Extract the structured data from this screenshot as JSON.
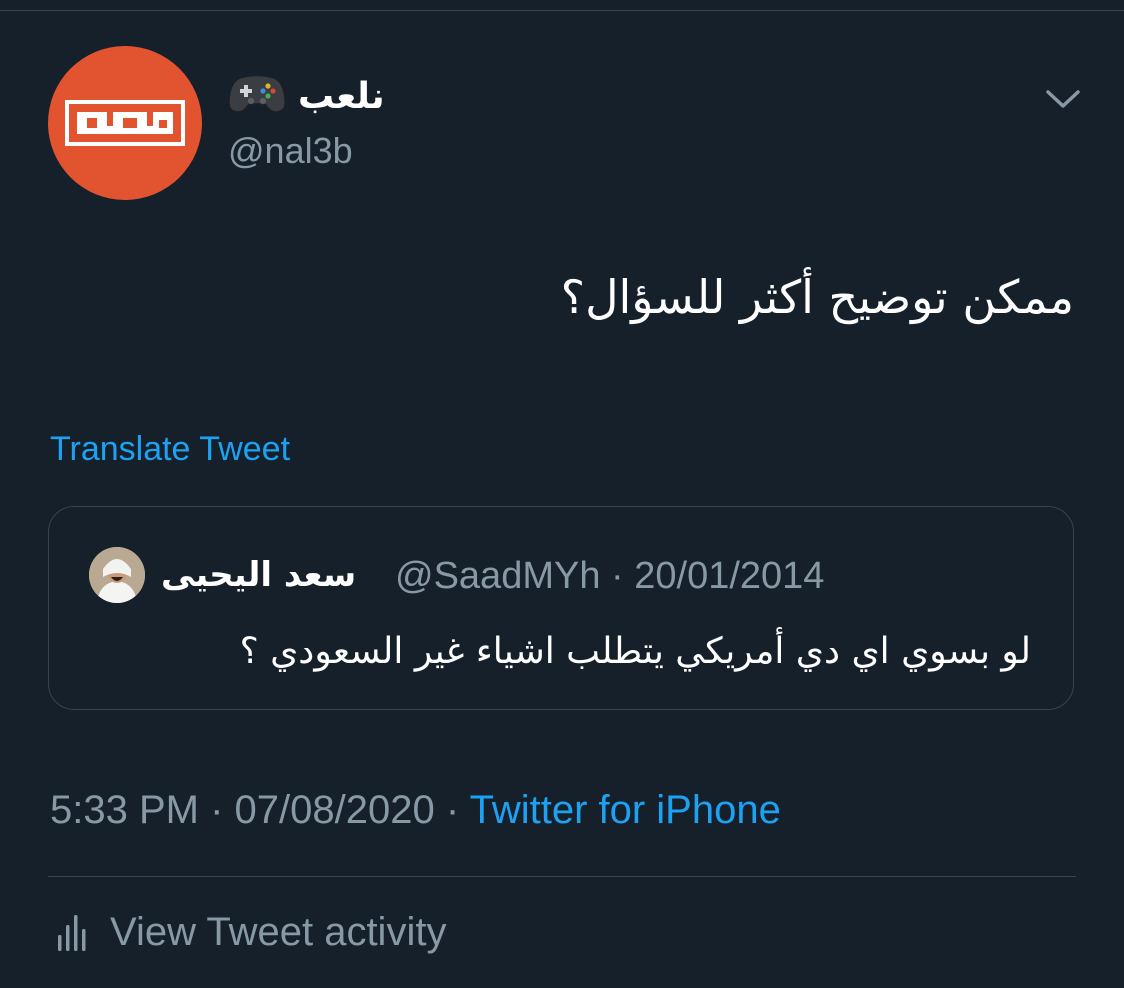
{
  "author": {
    "display_name": "نلعب",
    "emoji_icon": "video-game-controller-icon",
    "handle": "@nal3b",
    "avatar_logo_text": "نلعب",
    "avatar_color": "#e2532f"
  },
  "tweet": {
    "text": "ممكن توضيح أكثر للسؤال؟",
    "translate_label": "Translate Tweet"
  },
  "quote": {
    "author_name": "سعد اليحيى",
    "author_handle": "@SaadMYh",
    "separator": "·",
    "date": "20/01/2014",
    "text": "لو بسوي اي دي أمريكي يتطلب اشياء غير السعودي ؟"
  },
  "meta": {
    "time": "5:33 PM",
    "separator": "·",
    "date": "07/08/2020",
    "source": "Twitter for iPhone"
  },
  "activity": {
    "label": "View Tweet activity",
    "icon": "bar-chart-icon"
  },
  "colors": {
    "background": "#15202b",
    "accent": "#1da1f2",
    "secondary_text": "#8899a6",
    "border": "#38444d"
  }
}
